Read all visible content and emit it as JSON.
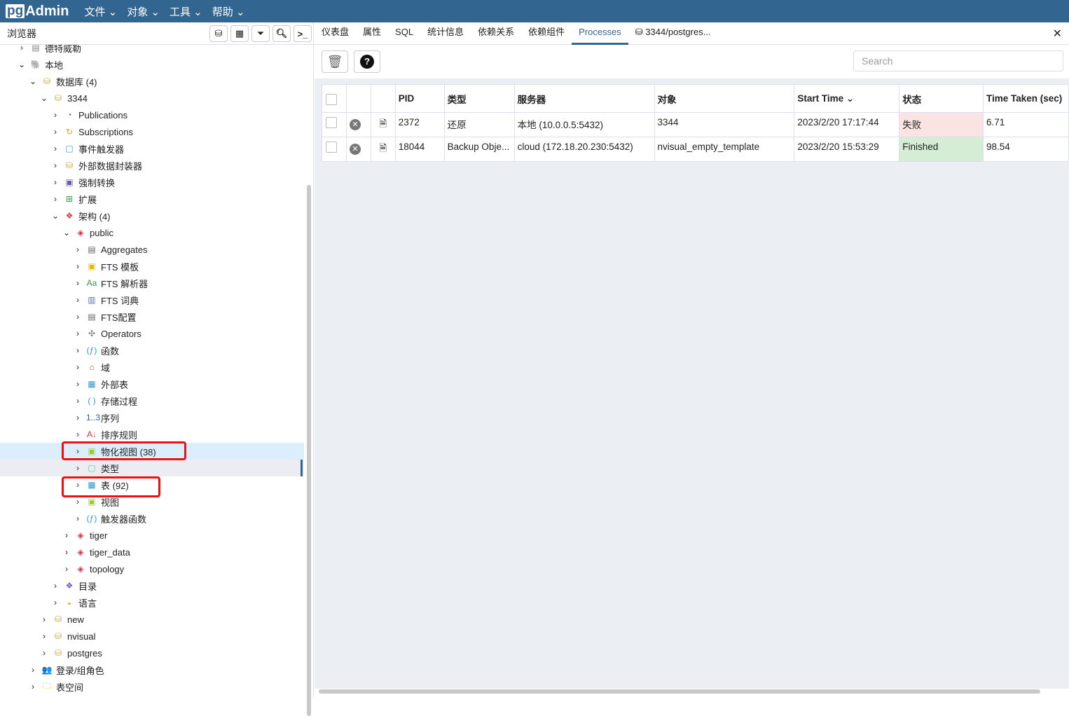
{
  "app": {
    "logo": "pgAdmin",
    "menus": [
      "文件",
      "对象",
      "工具",
      "帮助"
    ]
  },
  "browser": {
    "title": "浏览器",
    "toolbar_icons": [
      "query-tool-icon",
      "view-data-icon",
      "filter-rows-icon",
      "search-objects-icon",
      "psql-tool-icon"
    ]
  },
  "tree": [
    {
      "label": "德特威勒",
      "level": 0,
      "state": "collapsed",
      "icon": "server-icon",
      "iconChar": "▤",
      "color": "#888"
    },
    {
      "label": "本地",
      "level": 0,
      "state": "expanded",
      "icon": "postgres-elephant-icon",
      "iconChar": "🐘",
      "color": "#336791"
    },
    {
      "label": "数据库 (4)",
      "level": 1,
      "state": "expanded",
      "icon": "databases-icon",
      "iconChar": "⛁",
      "color": "#c8a53c"
    },
    {
      "label": "3344",
      "level": 2,
      "state": "expanded",
      "icon": "database-icon",
      "iconChar": "⛁",
      "color": "#c8a53c"
    },
    {
      "label": "Publications",
      "level": 3,
      "state": "collapsed",
      "icon": "publication-icon",
      "iconChar": "◔",
      "color": "#5577cc"
    },
    {
      "label": "Subscriptions",
      "level": 3,
      "state": "collapsed",
      "icon": "subscription-icon",
      "iconChar": "↻",
      "color": "#e0a030"
    },
    {
      "label": "事件触发器",
      "level": 3,
      "state": "collapsed",
      "icon": "event-trigger-icon",
      "iconChar": "▢",
      "color": "#3399cc"
    },
    {
      "label": "外部数据封装器",
      "level": 3,
      "state": "collapsed",
      "icon": "fdw-icon",
      "iconChar": "⛁",
      "color": "#c8a53c"
    },
    {
      "label": "强制转换",
      "level": 3,
      "state": "collapsed",
      "icon": "cast-icon",
      "iconChar": "▣",
      "color": "#6655bb"
    },
    {
      "label": "扩展",
      "level": 3,
      "state": "collapsed",
      "icon": "extension-icon",
      "iconChar": "⊞",
      "color": "#339944"
    },
    {
      "label": "架构 (4)",
      "level": 3,
      "state": "expanded",
      "icon": "schemas-icon",
      "iconChar": "❖",
      "color": "#dd3344"
    },
    {
      "label": "public",
      "level": 4,
      "state": "expanded",
      "icon": "schema-icon",
      "iconChar": "◈",
      "color": "#dd3344"
    },
    {
      "label": "Aggregates",
      "level": 5,
      "state": "collapsed",
      "icon": "aggregate-icon",
      "iconChar": "▤",
      "color": "#666"
    },
    {
      "label": "FTS 模板",
      "level": 5,
      "state": "collapsed",
      "icon": "fts-template-icon",
      "iconChar": "▣",
      "color": "#e6b800"
    },
    {
      "label": "FTS 解析器",
      "level": 5,
      "state": "collapsed",
      "icon": "fts-parser-icon",
      "iconChar": "Aa",
      "color": "#339944"
    },
    {
      "label": "FTS 词典",
      "level": 5,
      "state": "collapsed",
      "icon": "fts-dictionary-icon",
      "iconChar": "▥",
      "color": "#5577aa"
    },
    {
      "label": "FTS配置",
      "level": 5,
      "state": "collapsed",
      "icon": "fts-configuration-icon",
      "iconChar": "▤",
      "color": "#666"
    },
    {
      "label": "Operators",
      "level": 5,
      "state": "collapsed",
      "icon": "operator-icon",
      "iconChar": "✣",
      "color": "#777"
    },
    {
      "label": "函数",
      "level": 5,
      "state": "collapsed",
      "icon": "function-icon",
      "iconChar": "(ƒ)",
      "color": "#3399cc"
    },
    {
      "label": "域",
      "level": 5,
      "state": "collapsed",
      "icon": "domain-icon",
      "iconChar": "⌂",
      "color": "#996633"
    },
    {
      "label": "外部表",
      "level": 5,
      "state": "collapsed",
      "icon": "foreign-table-icon",
      "iconChar": "▦",
      "color": "#3399cc"
    },
    {
      "label": "存储过程",
      "level": 5,
      "state": "collapsed",
      "icon": "procedure-icon",
      "iconChar": "( )",
      "color": "#3399cc"
    },
    {
      "label": "序列",
      "level": 5,
      "state": "collapsed",
      "icon": "sequence-icon",
      "iconChar": "1..3",
      "color": "#3355aa"
    },
    {
      "label": "排序规则",
      "level": 5,
      "state": "collapsed",
      "icon": "collation-icon",
      "iconChar": "A↓",
      "color": "#dd3344"
    },
    {
      "label": "物化视图 (38)",
      "level": 5,
      "state": "collapsed",
      "icon": "materialized-view-icon",
      "iconChar": "▣",
      "color": "#99cc33",
      "selected": true
    },
    {
      "label": "类型",
      "level": 5,
      "state": "collapsed",
      "icon": "type-icon",
      "iconChar": "▢",
      "color": "#66cc99",
      "hover": true
    },
    {
      "label": "表 (92)",
      "level": 5,
      "state": "collapsed",
      "icon": "table-icon",
      "iconChar": "▦",
      "color": "#3399cc"
    },
    {
      "label": "视图",
      "level": 5,
      "state": "collapsed",
      "icon": "view-icon",
      "iconChar": "▣",
      "color": "#99cc33"
    },
    {
      "label": "触发器函数",
      "level": 5,
      "state": "collapsed",
      "icon": "trigger-function-icon",
      "iconChar": "(ƒ)",
      "color": "#3399cc"
    },
    {
      "label": "tiger",
      "level": 4,
      "state": "collapsed",
      "icon": "schema-icon",
      "iconChar": "◈",
      "color": "#dd3344"
    },
    {
      "label": "tiger_data",
      "level": 4,
      "state": "collapsed",
      "icon": "schema-icon",
      "iconChar": "◈",
      "color": "#dd3344"
    },
    {
      "label": "topology",
      "level": 4,
      "state": "collapsed",
      "icon": "schema-icon",
      "iconChar": "◈",
      "color": "#dd3344"
    },
    {
      "label": "目录",
      "level": 3,
      "state": "collapsed",
      "icon": "catalog-icon",
      "iconChar": "❖",
      "color": "#7755cc"
    },
    {
      "label": "语言",
      "level": 3,
      "state": "collapsed",
      "icon": "language-icon",
      "iconChar": "◒",
      "color": "#e6b800"
    },
    {
      "label": "new",
      "level": 2,
      "state": "collapsed",
      "icon": "database-icon",
      "iconChar": "⛁",
      "color": "#c8a53c"
    },
    {
      "label": "nvisual",
      "level": 2,
      "state": "collapsed",
      "icon": "database-icon",
      "iconChar": "⛁",
      "color": "#c8a53c"
    },
    {
      "label": "postgres",
      "level": 2,
      "state": "collapsed",
      "icon": "database-icon",
      "iconChar": "⛁",
      "color": "#c8a53c"
    },
    {
      "label": "登录/组角色",
      "level": 1,
      "state": "collapsed",
      "icon": "roles-icon",
      "iconChar": "👥",
      "color": "#dd3344"
    },
    {
      "label": "表空间",
      "level": 1,
      "state": "collapsed",
      "icon": "tablespace-icon",
      "iconChar": "🗀",
      "color": "#e6b800"
    }
  ],
  "tabs": [
    {
      "label": "仪表盘"
    },
    {
      "label": "属性"
    },
    {
      "label": "SQL"
    },
    {
      "label": "统计信息"
    },
    {
      "label": "依赖关系"
    },
    {
      "label": "依赖组件"
    },
    {
      "label": "Processes",
      "active": true
    },
    {
      "label": "3344/postgres...",
      "icon": "query-tool-icon"
    }
  ],
  "processes": {
    "search_placeholder": "Search",
    "columns": [
      "PID",
      "类型",
      "服务器",
      "对象",
      "Start Time",
      "状态",
      "Time Taken (sec)"
    ],
    "sort_column": "Start Time",
    "rows": [
      {
        "pid": "2372",
        "type": "还原",
        "server": "本地 (10.0.0.5:5432)",
        "object": "3344",
        "start": "2023/2/20 17:17:44",
        "status": "失败",
        "status_color": "#fae3e3",
        "time": "6.71"
      },
      {
        "pid": "18044",
        "type": "Backup Obje...",
        "server": "cloud (172.18.20.230:5432)",
        "object": "nvisual_empty_template",
        "start": "2023/2/20 15:53:29",
        "status": "Finished",
        "status_color": "#d5ecd5",
        "time": "98.54"
      }
    ]
  }
}
